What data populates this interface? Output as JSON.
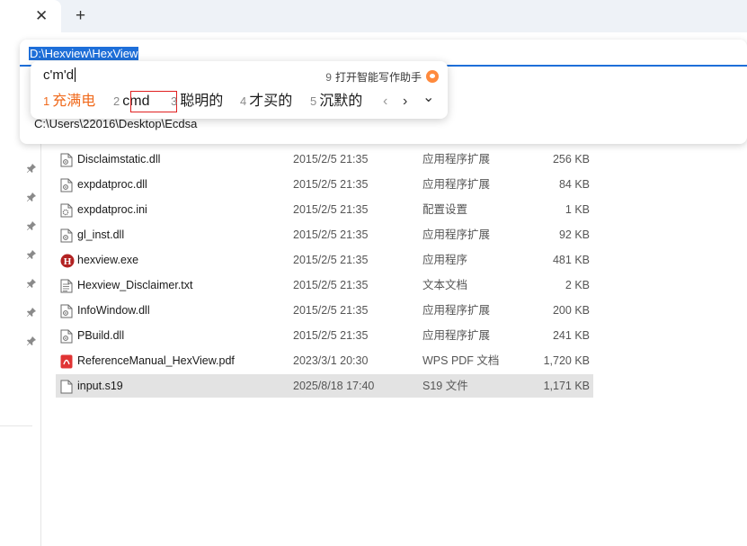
{
  "tabbar": {
    "close_glyph": "✕",
    "new_tab_glyph": "+"
  },
  "address_bar": {
    "value": "D:\\Hexview\\HexView",
    "suggestion": "C:\\Users\\22016\\Desktop\\Ecdsa",
    "accent_color": "#1e6fd9"
  },
  "ime": {
    "composition": "c'm'd",
    "assistant_num": "9",
    "assistant_label": "打开智能写作助手",
    "assistant_icon": "fox-icon",
    "candidates": [
      {
        "num": "1",
        "text": "充满电"
      },
      {
        "num": "2",
        "text": "cmd"
      },
      {
        "num": "3",
        "text": "聪明的"
      },
      {
        "num": "4",
        "text": "才买的"
      },
      {
        "num": "5",
        "text": "沉默的"
      }
    ],
    "prev_glyph": "‹",
    "next_glyph": "›",
    "expand_glyph": "⌄",
    "highlight_color": "#e02020",
    "first_color": "#f06a1c"
  },
  "files": [
    {
      "name": "Disclaimstatic.dll",
      "date": "2015/2/5 21:35",
      "type": "应用程序扩展",
      "size": "256 KB",
      "icon": "dll-file-icon"
    },
    {
      "name": "expdatproc.dll",
      "date": "2015/2/5 21:35",
      "type": "应用程序扩展",
      "size": "84 KB",
      "icon": "dll-file-icon"
    },
    {
      "name": "expdatproc.ini",
      "date": "2015/2/5 21:35",
      "type": "配置设置",
      "size": "1 KB",
      "icon": "ini-file-icon"
    },
    {
      "name": "gl_inst.dll",
      "date": "2015/2/5 21:35",
      "type": "应用程序扩展",
      "size": "92 KB",
      "icon": "dll-file-icon"
    },
    {
      "name": "hexview.exe",
      "date": "2015/2/5 21:35",
      "type": "应用程序",
      "size": "481 KB",
      "icon": "hexview-app-icon"
    },
    {
      "name": "Hexview_Disclaimer.txt",
      "date": "2015/2/5 21:35",
      "type": "文本文档",
      "size": "2 KB",
      "icon": "text-file-icon"
    },
    {
      "name": "InfoWindow.dll",
      "date": "2015/2/5 21:35",
      "type": "应用程序扩展",
      "size": "200 KB",
      "icon": "dll-file-icon"
    },
    {
      "name": "PBuild.dll",
      "date": "2015/2/5 21:35",
      "type": "应用程序扩展",
      "size": "241 KB",
      "icon": "dll-file-icon"
    },
    {
      "name": "ReferenceManual_HexView.pdf",
      "date": "2023/3/1 20:30",
      "type": "WPS PDF 文档",
      "size": "1,720 KB",
      "icon": "pdf-file-icon"
    },
    {
      "name": "input.s19",
      "date": "2025/8/18 17:40",
      "type": "S19 文件",
      "size": "1,171 KB",
      "icon": "generic-file-icon",
      "selected": true
    }
  ],
  "sidebar": {
    "pin_icon": "pin-icon",
    "pin_count": 7
  }
}
